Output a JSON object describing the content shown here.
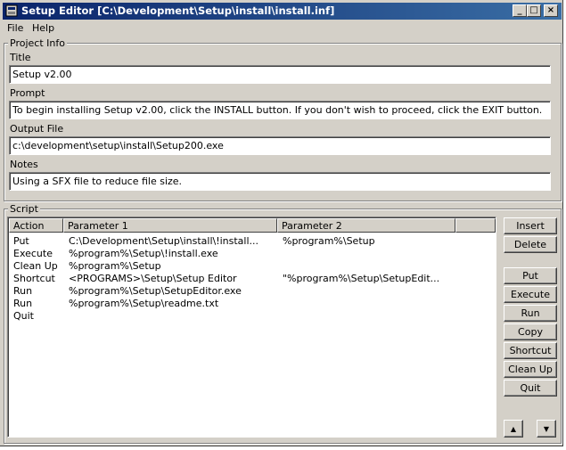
{
  "window": {
    "title": "Setup Editor [C:\\Development\\Setup\\install\\install.inf]",
    "controls": {
      "minimize": "_",
      "maximize": "□",
      "close": "×"
    }
  },
  "menu": [
    "File",
    "Help"
  ],
  "project_info": {
    "group_label": "Project Info",
    "title_label": "Title",
    "title_value": "Setup v2.00",
    "prompt_label": "Prompt",
    "prompt_value": "To begin installing Setup v2.00, click the INSTALL button. If you don't wish to proceed, click the EXIT button.",
    "output_label": "Output File",
    "output_value": "c:\\development\\setup\\install\\Setup200.exe",
    "notes_label": "Notes",
    "notes_value": "Using a SFX file to reduce file size."
  },
  "script": {
    "group_label": "Script",
    "columns": [
      "Action",
      "Parameter 1",
      "Parameter 2"
    ],
    "rows": [
      {
        "action": "Put",
        "p1": "C:\\Development\\Setup\\install\\!install...",
        "p2": "%program%\\Setup"
      },
      {
        "action": "Execute",
        "p1": "%program%\\Setup\\!install.exe",
        "p2": ""
      },
      {
        "action": "Clean Up",
        "p1": "%program%\\Setup",
        "p2": ""
      },
      {
        "action": "Shortcut",
        "p1": "<PROGRAMS>\\Setup\\Setup Editor",
        "p2": "\"%program%\\Setup\\SetupEdit..."
      },
      {
        "action": "Run",
        "p1": "%program%\\Setup\\SetupEditor.exe",
        "p2": ""
      },
      {
        "action": "Run",
        "p1": "%program%\\Setup\\readme.txt",
        "p2": ""
      },
      {
        "action": "Quit",
        "p1": "",
        "p2": ""
      }
    ],
    "buttons": {
      "insert": "Insert",
      "delete": "Delete",
      "put": "Put",
      "execute": "Execute",
      "run": "Run",
      "copy": "Copy",
      "shortcut": "Shortcut",
      "cleanup": "Clean Up",
      "quit": "Quit"
    }
  },
  "icons": {
    "app": "setup-app-icon",
    "up": "arrow-up-icon",
    "down": "arrow-down-icon"
  }
}
